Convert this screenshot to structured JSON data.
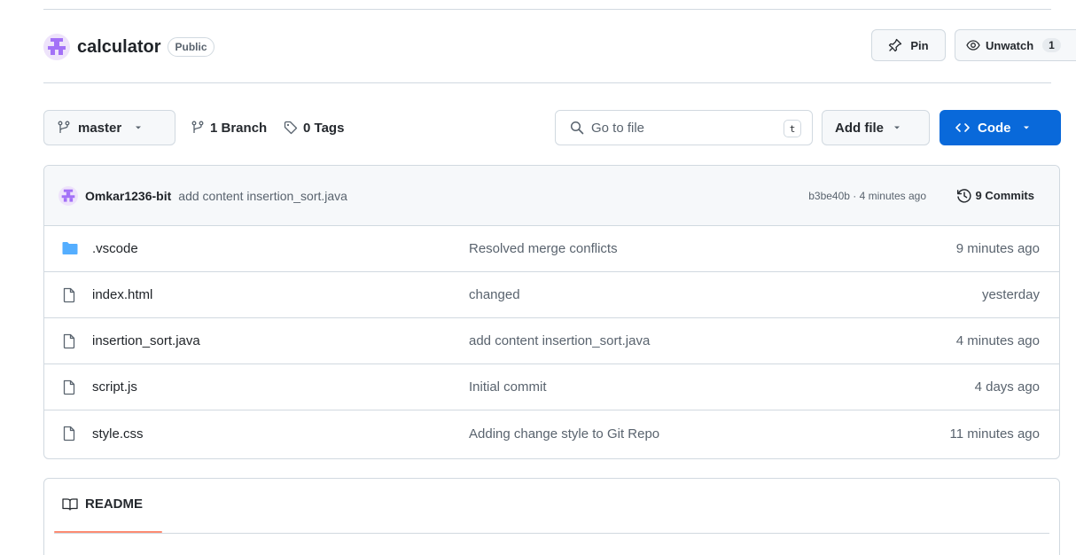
{
  "repo": {
    "name": "calculator",
    "visibility": "Public",
    "pin_label": "Pin",
    "watch_label": "Unwatch",
    "watch_count": "1"
  },
  "toolbar": {
    "branch_name": "master",
    "branch_count": "1",
    "branch_label": "Branch",
    "tag_count": "0",
    "tag_label": "Tags",
    "search_placeholder": "Go to file",
    "search_shortcut": "t",
    "add_file_label": "Add file",
    "code_label": "Code"
  },
  "latest_commit": {
    "author": "Omkar1236-bit",
    "message": "add content insertion_sort.java",
    "hash_time": "b3be40b · 4 minutes ago",
    "commits_label": "9 Commits"
  },
  "files": [
    {
      "name": ".vscode",
      "type": "folder",
      "message": "Resolved merge conflicts",
      "time": "9 minutes ago"
    },
    {
      "name": "index.html",
      "type": "file",
      "message": "changed",
      "time": "yesterday"
    },
    {
      "name": "insertion_sort.java",
      "type": "file",
      "message": "add content insertion_sort.java",
      "time": "4 minutes ago"
    },
    {
      "name": "script.js",
      "type": "file",
      "message": "Initial commit",
      "time": "4 days ago"
    },
    {
      "name": "style.css",
      "type": "file",
      "message": "Adding change style to Git Repo",
      "time": "11 minutes ago"
    }
  ],
  "readme": {
    "title": "README"
  },
  "colors": {
    "accent": "#0969da",
    "folder": "#54aeff",
    "avatar": "#a371f7",
    "tab_underline": "#fd8c73"
  },
  "icons": {
    "avatar": "identicon-avatar",
    "pin": "pin-icon",
    "watch": "eye-icon",
    "branch": "git-branch-icon",
    "tag": "tag-icon",
    "search": "search-icon",
    "code": "code-icon",
    "history": "history-icon",
    "folder": "folder-icon",
    "file": "file-icon",
    "book": "book-icon"
  }
}
